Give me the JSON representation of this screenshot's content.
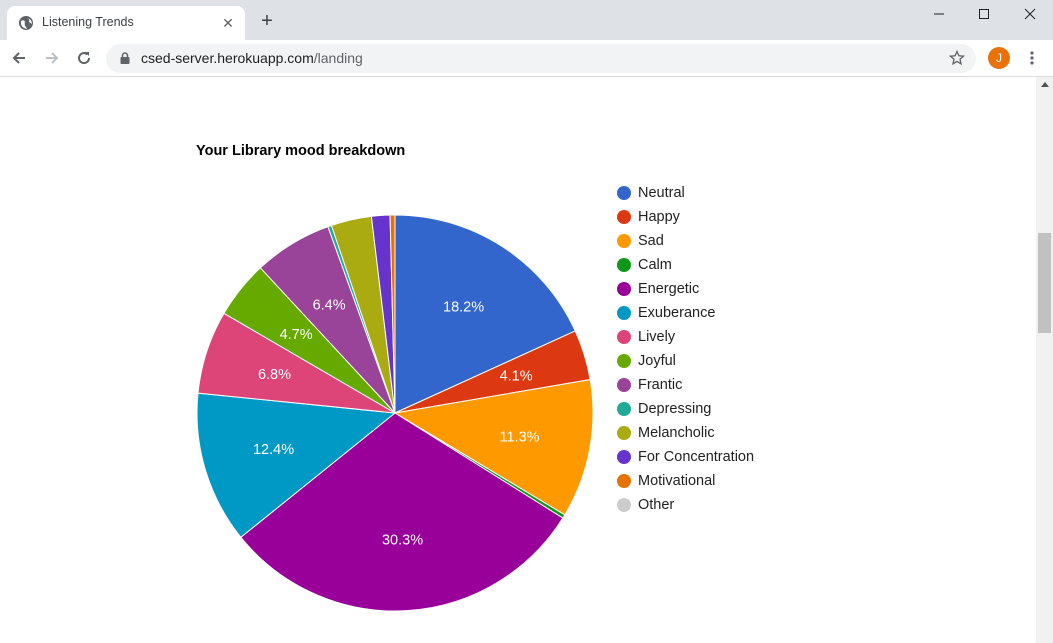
{
  "browser": {
    "tab_title": "Listening Trends",
    "url_host": "csed-server.herokuapp.com",
    "url_path": "/landing",
    "avatar_letter": "J",
    "icons": [
      "globe-icon",
      "close-icon",
      "plus-icon",
      "minimize-icon",
      "maximize-icon",
      "back-icon",
      "forward-icon",
      "reload-icon",
      "lock-icon",
      "star-icon",
      "kebab-menu-icon"
    ]
  },
  "chart_data": {
    "type": "pie",
    "title": "Your Library mood breakdown",
    "legend_position": "right",
    "slices": [
      {
        "label": "Neutral",
        "value": 18.2,
        "color": "#3366cc",
        "show_label": true
      },
      {
        "label": "Happy",
        "value": 4.1,
        "color": "#dc3912",
        "show_label": true
      },
      {
        "label": "Sad",
        "value": 11.3,
        "color": "#ff9900",
        "show_label": true
      },
      {
        "label": "Calm",
        "value": 0.3,
        "color": "#109618",
        "show_label": false
      },
      {
        "label": "Energetic",
        "value": 30.3,
        "color": "#990099",
        "show_label": true
      },
      {
        "label": "Exuberance",
        "value": 12.4,
        "color": "#0099c6",
        "show_label": true
      },
      {
        "label": "Lively",
        "value": 6.8,
        "color": "#dd4477",
        "show_label": true
      },
      {
        "label": "Joyful",
        "value": 4.7,
        "color": "#66aa00",
        "show_label": true
      },
      {
        "label": "Frantic",
        "value": 6.4,
        "color": "#994499",
        "show_label": true
      },
      {
        "label": "Depressing",
        "value": 0.3,
        "color": "#22aa99",
        "show_label": false
      },
      {
        "label": "Melancholic",
        "value": 3.3,
        "color": "#aaaa11",
        "show_label": false
      },
      {
        "label": "For Concentration",
        "value": 1.5,
        "color": "#6633cc",
        "show_label": false
      },
      {
        "label": "Motivational",
        "value": 0.4,
        "color": "#e67300",
        "show_label": false
      },
      {
        "label": "Other",
        "value": 0.0,
        "color": "#cccccc",
        "show_label": false
      }
    ]
  }
}
